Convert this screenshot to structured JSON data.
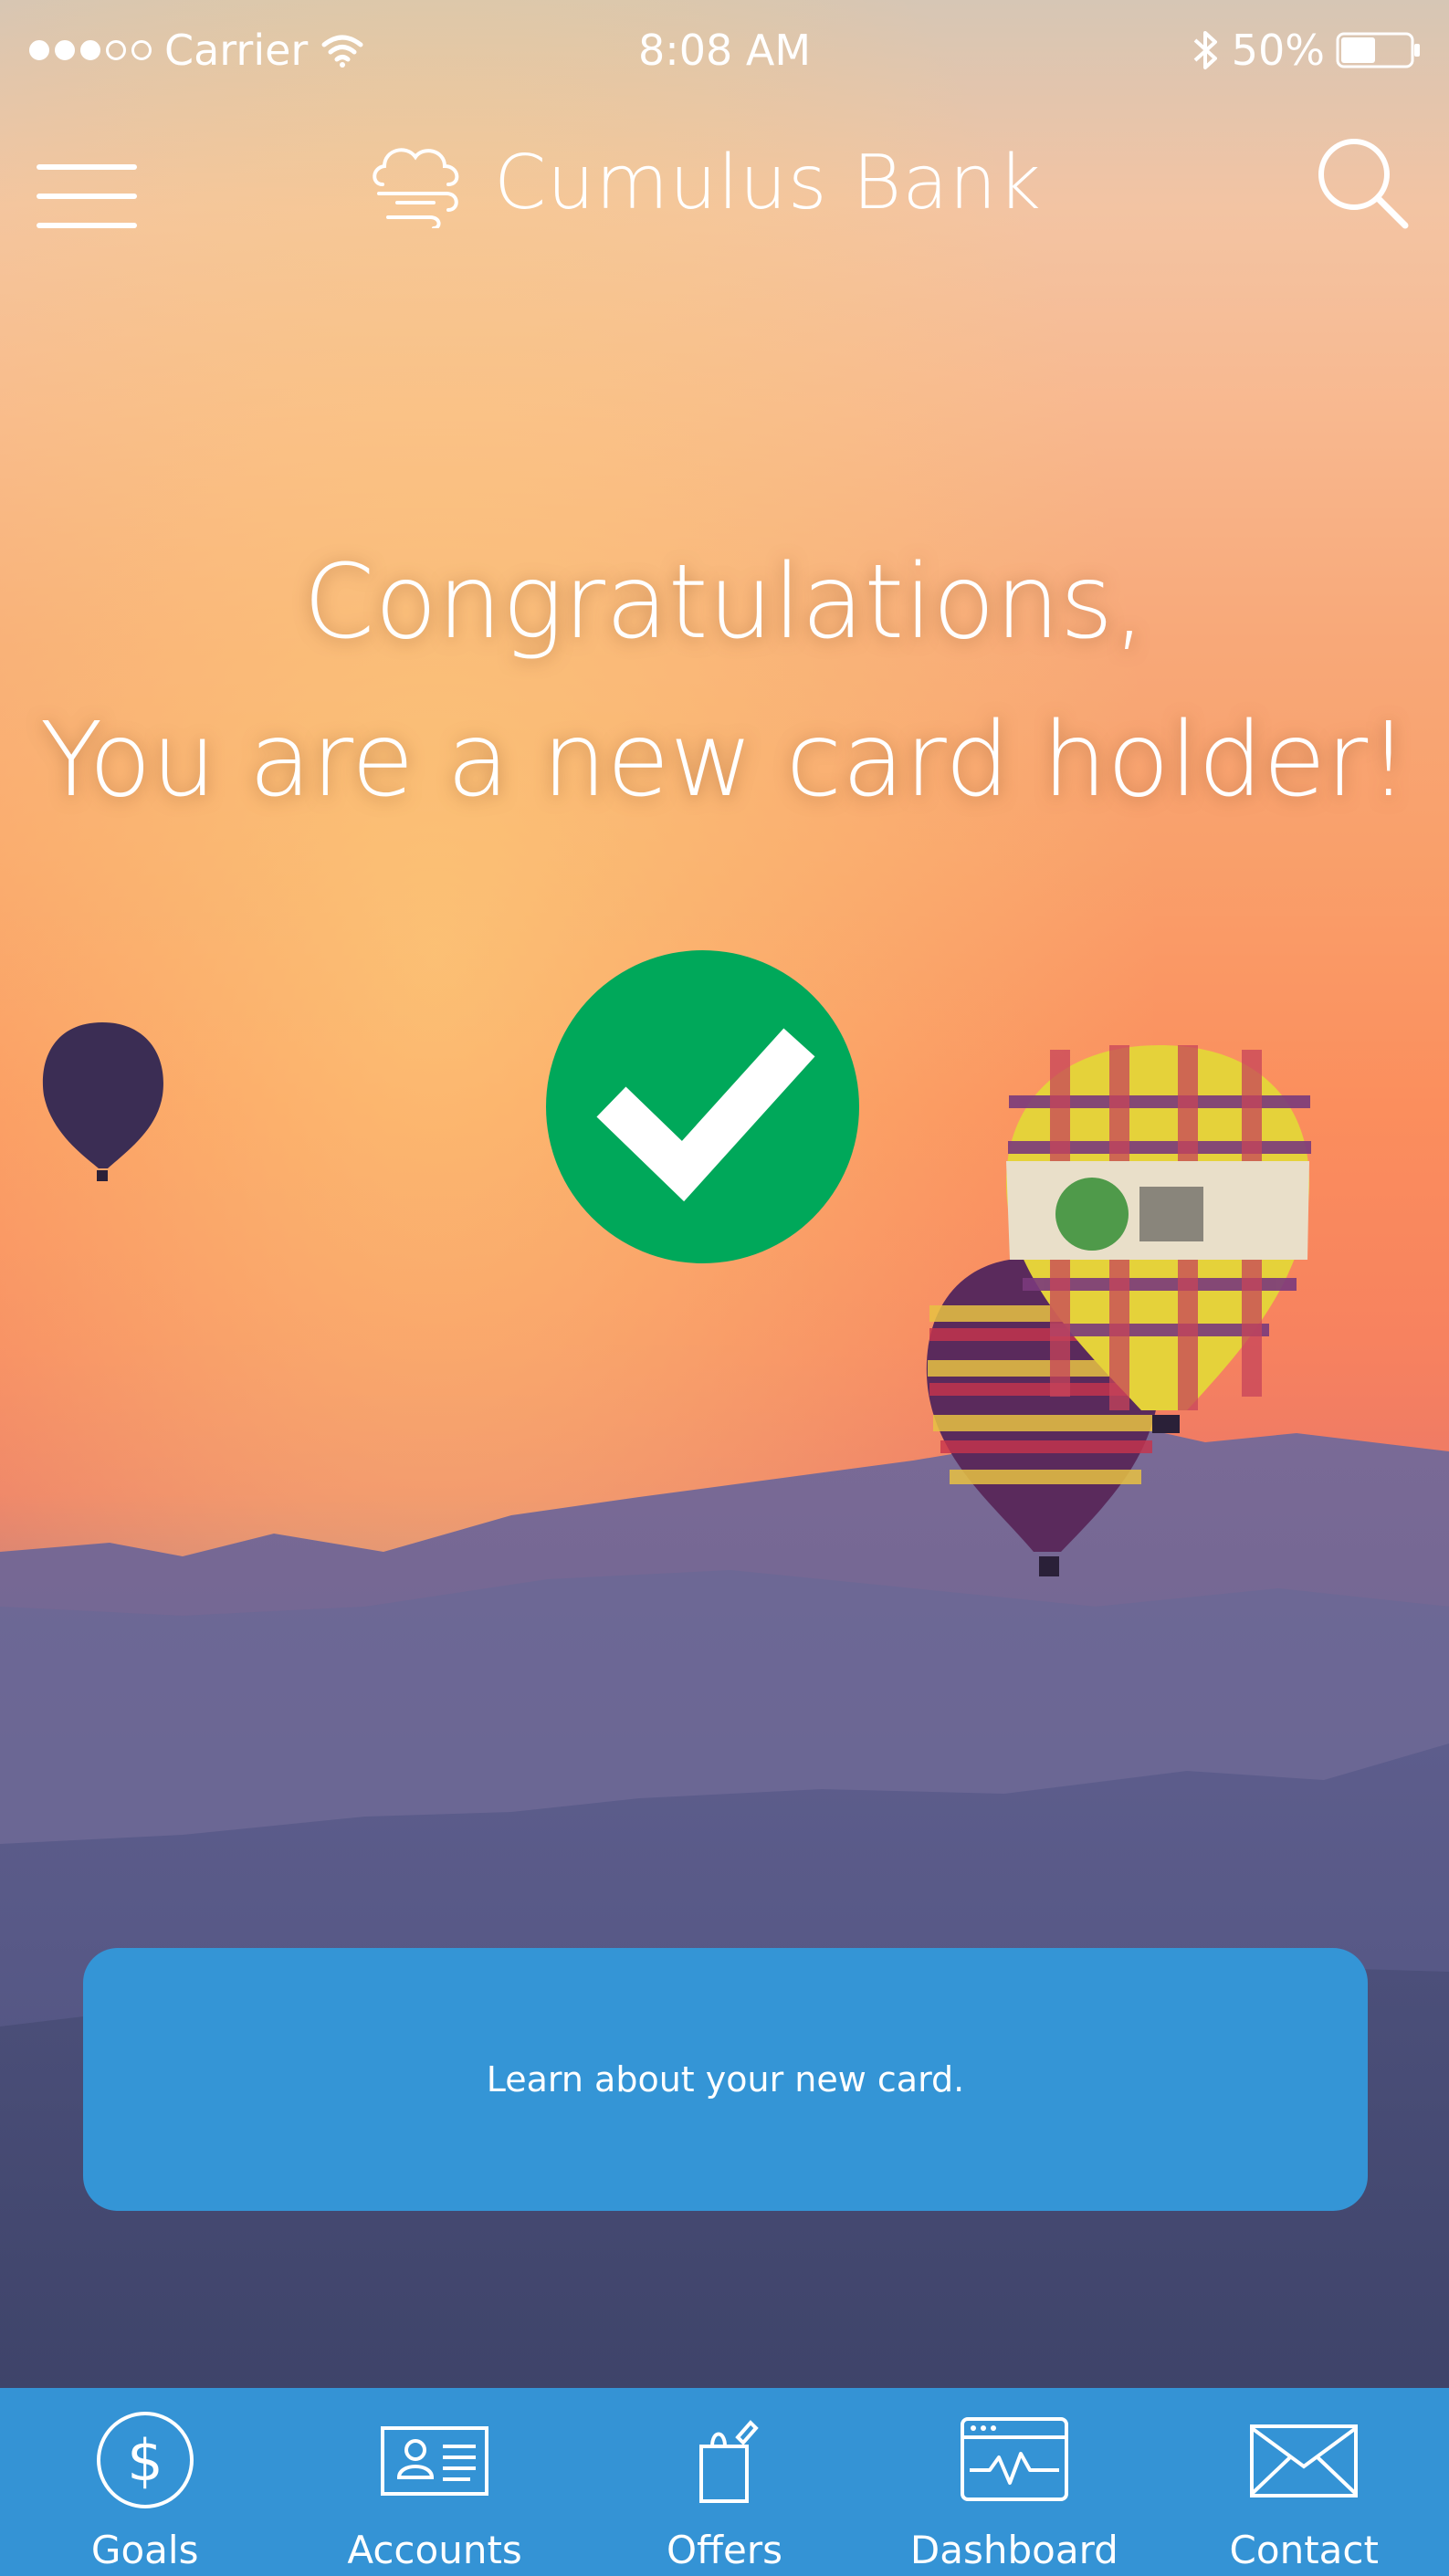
{
  "status_bar": {
    "carrier": "Carrier",
    "time": "8:08 AM",
    "battery": "50%",
    "battery_level": 0.5,
    "signal_bars": 3,
    "signal_total": 5
  },
  "nav": {
    "brand": "Cumulus Bank",
    "menu_icon": "hamburger-icon",
    "logo_icon": "cloud-wind-icon",
    "search_icon": "search-icon"
  },
  "hero": {
    "line1": "Congratulations,",
    "line2": "You are a new card holder!",
    "check_icon": "checkmark-icon",
    "check_color": "#00a85a"
  },
  "cta": {
    "label": "Learn about your new card.",
    "color": "#3495d6"
  },
  "tabbar": {
    "color": "#3493d5",
    "tabs": [
      {
        "label": "Goals",
        "icon": "dollar-circle-icon"
      },
      {
        "label": "Accounts",
        "icon": "id-card-icon"
      },
      {
        "label": "Offers",
        "icon": "gift-bag-icon"
      },
      {
        "label": "Dashboard",
        "icon": "dashboard-chart-icon"
      },
      {
        "label": "Contact",
        "icon": "envelope-icon"
      }
    ]
  }
}
